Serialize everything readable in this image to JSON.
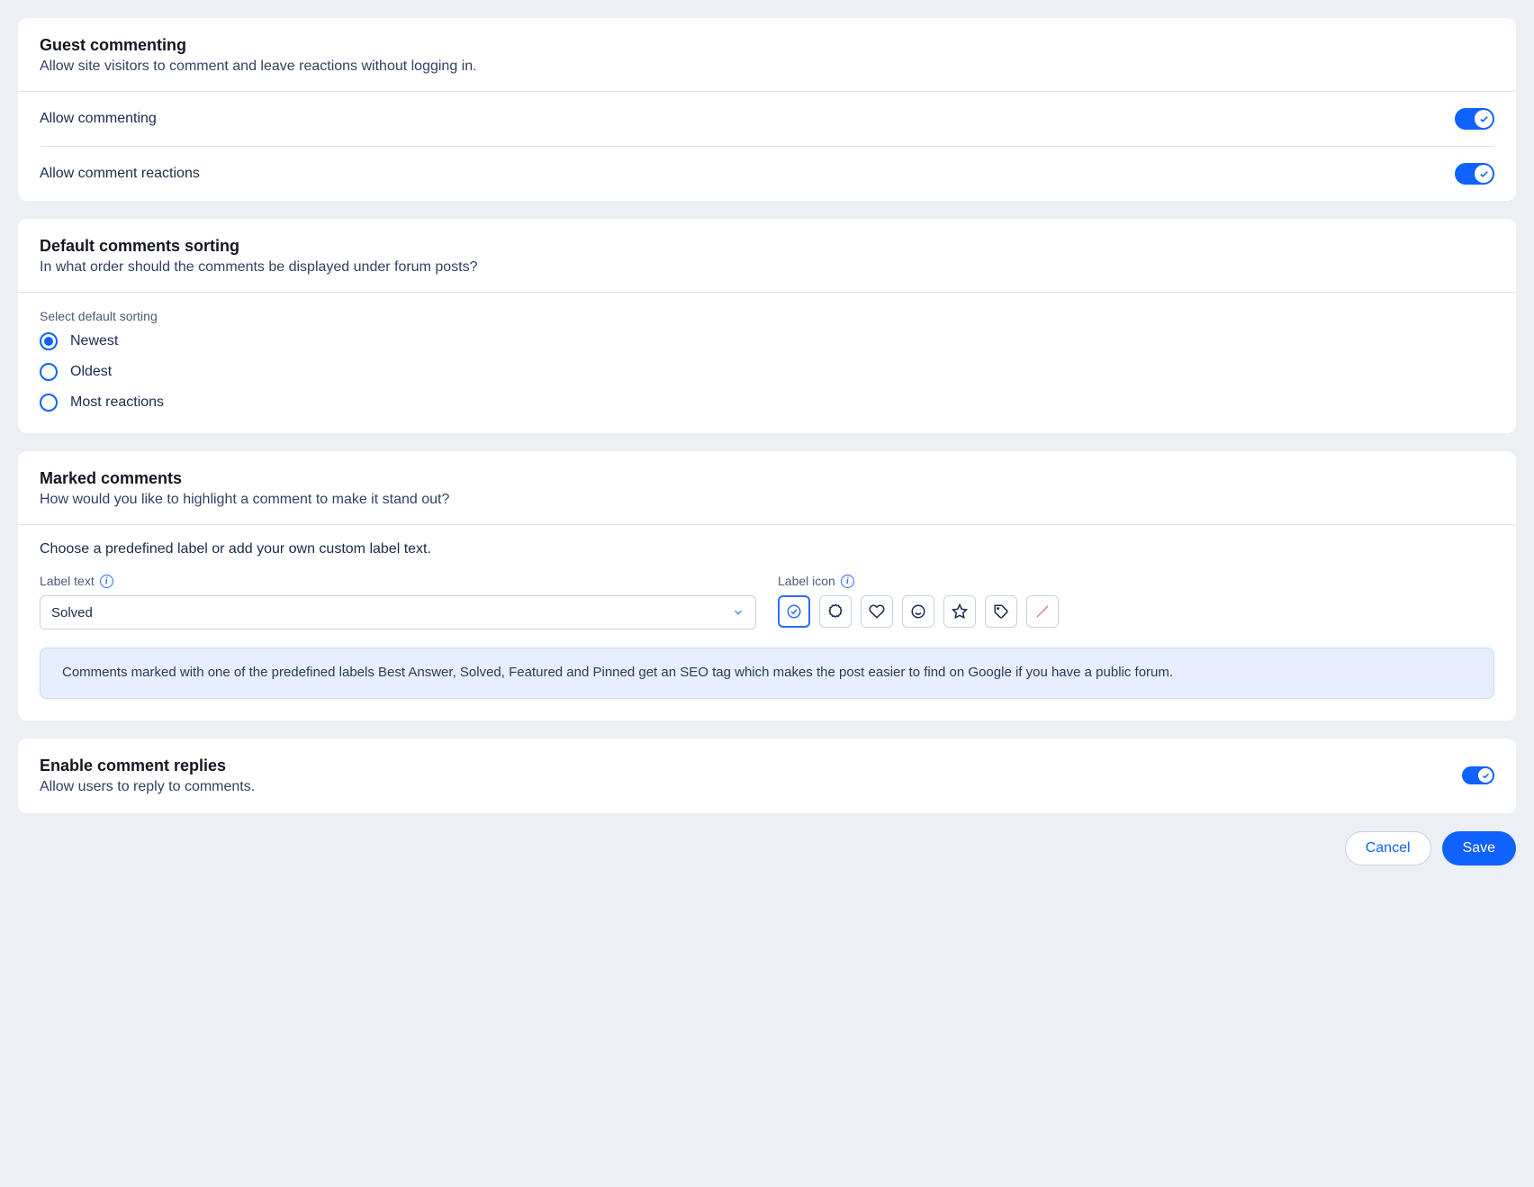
{
  "guest": {
    "title": "Guest commenting",
    "subtitle": "Allow site visitors to comment and leave reactions without logging in.",
    "allow_commenting": "Allow commenting",
    "allow_reactions": "Allow comment reactions"
  },
  "sorting": {
    "title": "Default comments sorting",
    "subtitle": "In what order should the comments be displayed under forum posts?",
    "select_label": "Select default sorting",
    "options": {
      "newest": "Newest",
      "oldest": "Oldest",
      "most_reactions": "Most reactions"
    }
  },
  "marked": {
    "title": "Marked comments",
    "subtitle": "How would you like to highlight a comment to make it stand out?",
    "choose_text": "Choose a predefined label or add your own custom label text.",
    "label_text": "Label text",
    "label_icon": "Label icon",
    "dropdown_value": "Solved",
    "banner": "Comments marked with one of the predefined labels Best Answer, Solved, Featured and Pinned get an SEO tag which makes the post easier to find on Google if you have a public forum."
  },
  "replies": {
    "title": "Enable comment replies",
    "subtitle": "Allow users to reply to comments."
  },
  "buttons": {
    "cancel": "Cancel",
    "save": "Save"
  }
}
